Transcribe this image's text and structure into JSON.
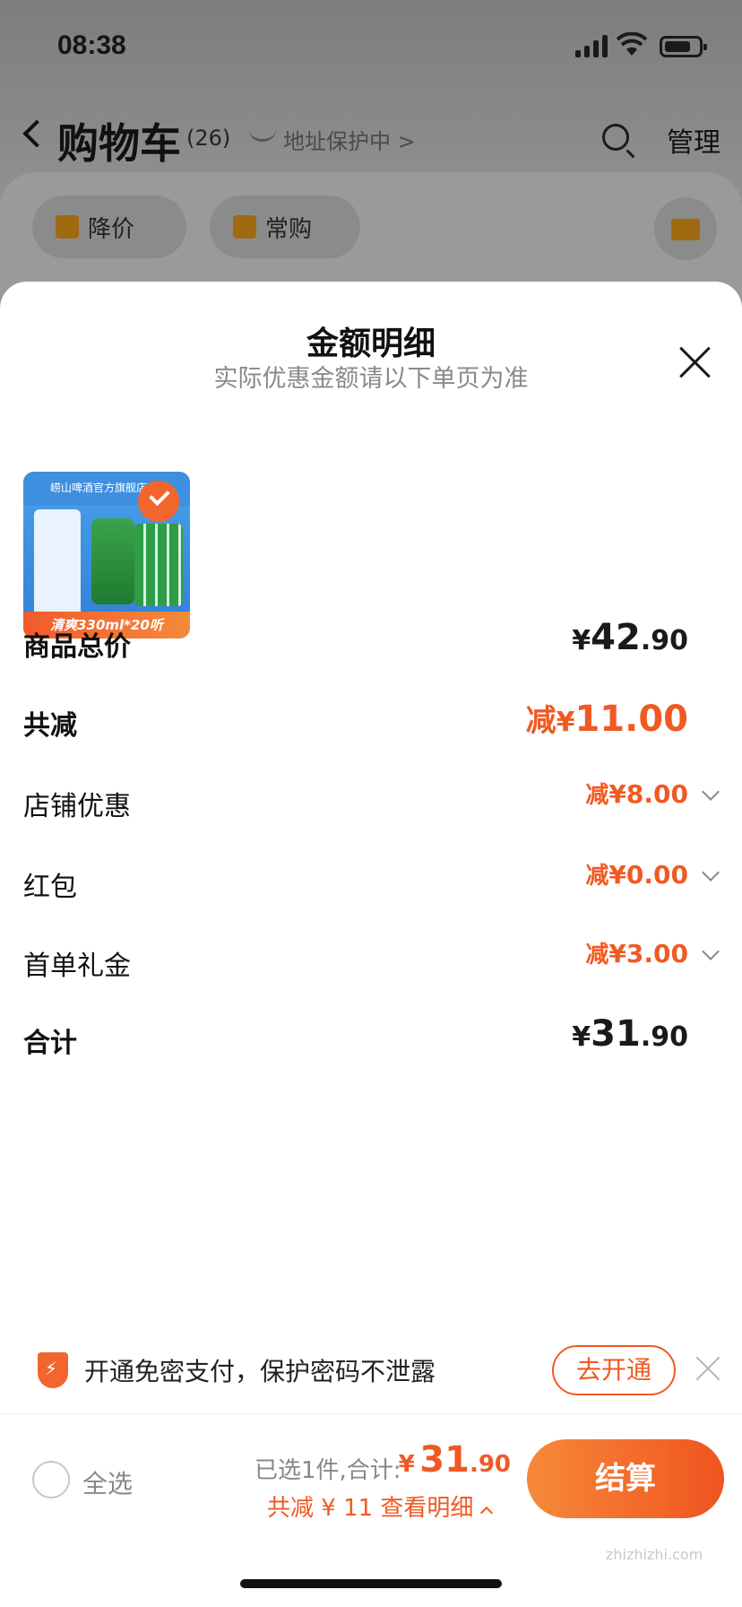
{
  "status_bar": {
    "time": "08:38"
  },
  "header": {
    "title": "购物车",
    "count": "(26)",
    "address_protect": "地址保护中 >",
    "manage": "管理"
  },
  "chips": [
    {
      "label": "降价"
    },
    {
      "label": "常购"
    }
  ],
  "sheet": {
    "title": "金额明细",
    "subtitle": "实际优惠金额请以下单页为准",
    "product": {
      "store_banner": "崂山啤酒官方旗舰店",
      "tag": "清爽330ml*20听"
    },
    "rows": {
      "subtotal": {
        "label": "商品总价",
        "symbol": "¥",
        "int": "42",
        "dec": ".90"
      },
      "total_discount": {
        "label": "共减",
        "prefix": "减",
        "symbol": "¥",
        "int": "11",
        "dec": ".00"
      },
      "store_discount": {
        "label": "店铺优惠",
        "prefix": "减",
        "symbol": "¥",
        "int": "8",
        "dec": ".00"
      },
      "red_packet": {
        "label": "红包",
        "prefix": "减",
        "symbol": "¥",
        "int": "0",
        "dec": ".00"
      },
      "first_order": {
        "label": "首单礼金",
        "prefix": "减",
        "symbol": "¥",
        "int": "3",
        "dec": ".00"
      },
      "total": {
        "label": "合计",
        "symbol": "¥",
        "int": "31",
        "dec": ".90"
      }
    }
  },
  "password_strip": {
    "text": "开通免密支付，保护密码不泄露",
    "button": "去开通"
  },
  "bottom_bar": {
    "select_all": "全选",
    "selected_label": "已选1件,合计:",
    "total_symbol": "¥",
    "total_int": "31",
    "total_dec": ".90",
    "discount_detail": "共减 ¥ 11  查看明细",
    "checkout": "结算"
  },
  "watermark": "zhizhizhi.com",
  "colors": {
    "accent": "#f05a22",
    "accent_light": "#f6893a",
    "text": "#111111",
    "muted": "#8a8a8a"
  }
}
